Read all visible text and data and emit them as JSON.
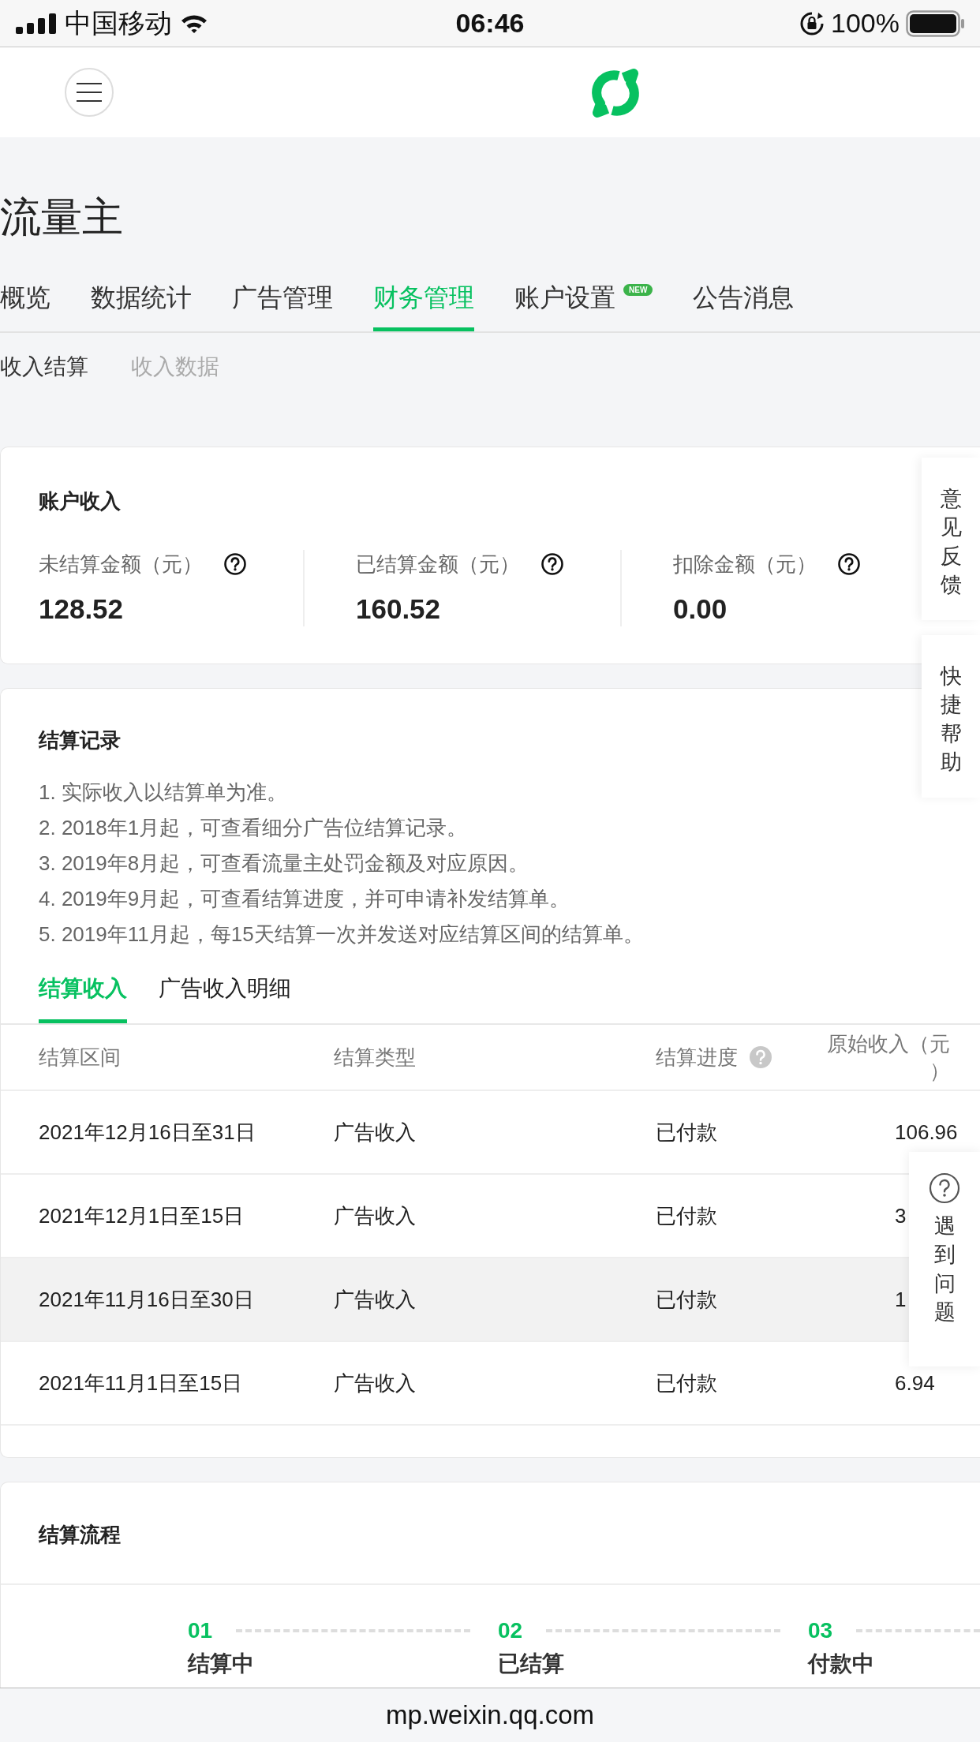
{
  "status_bar": {
    "carrier": "中国移动",
    "time": "06:46",
    "battery": "100%"
  },
  "page": {
    "title": "流量主"
  },
  "tabs": [
    {
      "label": "概览",
      "selected": false
    },
    {
      "label": "数据统计",
      "selected": false
    },
    {
      "label": "广告管理",
      "selected": false
    },
    {
      "label": "财务管理",
      "selected": true
    },
    {
      "label": "账户设置",
      "selected": false,
      "badge": "NEW"
    },
    {
      "label": "公告消息",
      "selected": false
    }
  ],
  "subtabs": [
    {
      "label": "收入结算",
      "selected": true
    },
    {
      "label": "收入数据",
      "selected": false
    }
  ],
  "income_card": {
    "title": "账户收入",
    "metrics": [
      {
        "label": "未结算金额（元）",
        "value": "128.52"
      },
      {
        "label": "已结算金额（元）",
        "value": "160.52"
      },
      {
        "label": "扣除金额（元）",
        "value": "0.00"
      }
    ]
  },
  "records_card": {
    "title": "结算记录",
    "notes": [
      "1. 实际收入以结算单为准。",
      "2. 2018年1月起，可查看细分广告位结算记录。",
      "3. 2019年8月起，可查看流量主处罚金额及对应原因。",
      "4. 2019年9月起，可查看结算进度，并可申请补发结算单。",
      "5. 2019年11月起，每15天结算一次并发送对应结算区间的结算单。"
    ],
    "tabs": [
      {
        "label": "结算收入",
        "selected": true
      },
      {
        "label": "广告收入明细",
        "selected": false
      }
    ],
    "table": {
      "columns": [
        {
          "label": "结算区间",
          "help": false
        },
        {
          "label": "结算类型",
          "help": false
        },
        {
          "label": "结算进度",
          "help": true
        },
        {
          "label": "原始收入（元）",
          "help": false
        }
      ],
      "rows": [
        {
          "cells": [
            "2021年12月16日至31日",
            "广告收入",
            "已付款",
            "106.96"
          ],
          "highlighted": false
        },
        {
          "cells": [
            "2021年12月1日至15日",
            "广告收入",
            "已付款",
            "3"
          ],
          "highlighted": false
        },
        {
          "cells": [
            "2021年11月16日至30日",
            "广告收入",
            "已付款",
            "1"
          ],
          "highlighted": true
        },
        {
          "cells": [
            "2021年11月1日至15日",
            "广告收入",
            "已付款",
            "6.94"
          ],
          "highlighted": false
        }
      ]
    }
  },
  "flow_card": {
    "title": "结算流程",
    "steps": [
      {
        "number": "01",
        "label": "结算中"
      },
      {
        "number": "02",
        "label": "已结算"
      },
      {
        "number": "03",
        "label": "付款中"
      }
    ]
  },
  "side_buttons": [
    {
      "label": "意见反馈"
    },
    {
      "label": "快捷帮助"
    }
  ],
  "help_float": {
    "label": "遇到问题"
  },
  "url_bar": {
    "url": "mp.weixin.qq.com"
  }
}
